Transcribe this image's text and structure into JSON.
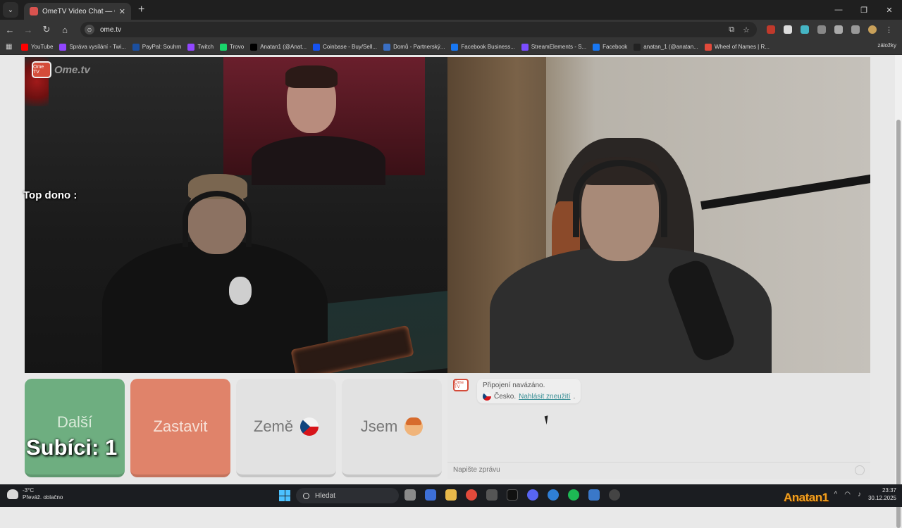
{
  "browser": {
    "tab_title": "OmeTV Video Chat — Ome",
    "url": "ome.tv",
    "bookmarks": [
      {
        "label": "YouTube",
        "color": "#ff0000"
      },
      {
        "label": "Správa vysílání - Twi...",
        "color": "#9146ff"
      },
      {
        "label": "PayPal: Souhrn",
        "color": "#1b4fa0"
      },
      {
        "label": "Twitch",
        "color": "#9146ff"
      },
      {
        "label": "Trovo",
        "color": "#19d66b"
      },
      {
        "label": "Anatan1 (@Anat...",
        "color": "#000000"
      },
      {
        "label": "Coinbase - Buy/Sell...",
        "color": "#1652f0"
      },
      {
        "label": "Domů - Partnerský...",
        "color": "#3a6fc4"
      },
      {
        "label": "Facebook Business...",
        "color": "#1877f2"
      },
      {
        "label": "StreamElements - S...",
        "color": "#7b4dff"
      },
      {
        "label": "Facebook",
        "color": "#1877f2"
      },
      {
        "label": "anatan_1 (@anatan...",
        "color": "#222222"
      },
      {
        "label": "Wheel of Names | R...",
        "color": "#e24a3b"
      }
    ],
    "bookmarks_more": "záložky"
  },
  "site": {
    "logo_text": "Ome.tv",
    "logo_badge": "Ome TV"
  },
  "overlay": {
    "top_dono": "Top dono :",
    "subs": "Subíci: 1",
    "watermark": "Anatan1"
  },
  "controls": {
    "next": "Další",
    "stop": "Zastavit",
    "country": "Země",
    "me": "Jsem"
  },
  "chat": {
    "connected": "Připojení navázáno.",
    "country": "Česko.",
    "report": "Nahlásit zneužití",
    "report_suffix": ".",
    "placeholder": "Napište zprávu"
  },
  "taskbar": {
    "temp": "-3°C",
    "weather": "Převáž. oblačno",
    "search": "Hledat",
    "time": "23:37",
    "date": "30.12.2025"
  }
}
